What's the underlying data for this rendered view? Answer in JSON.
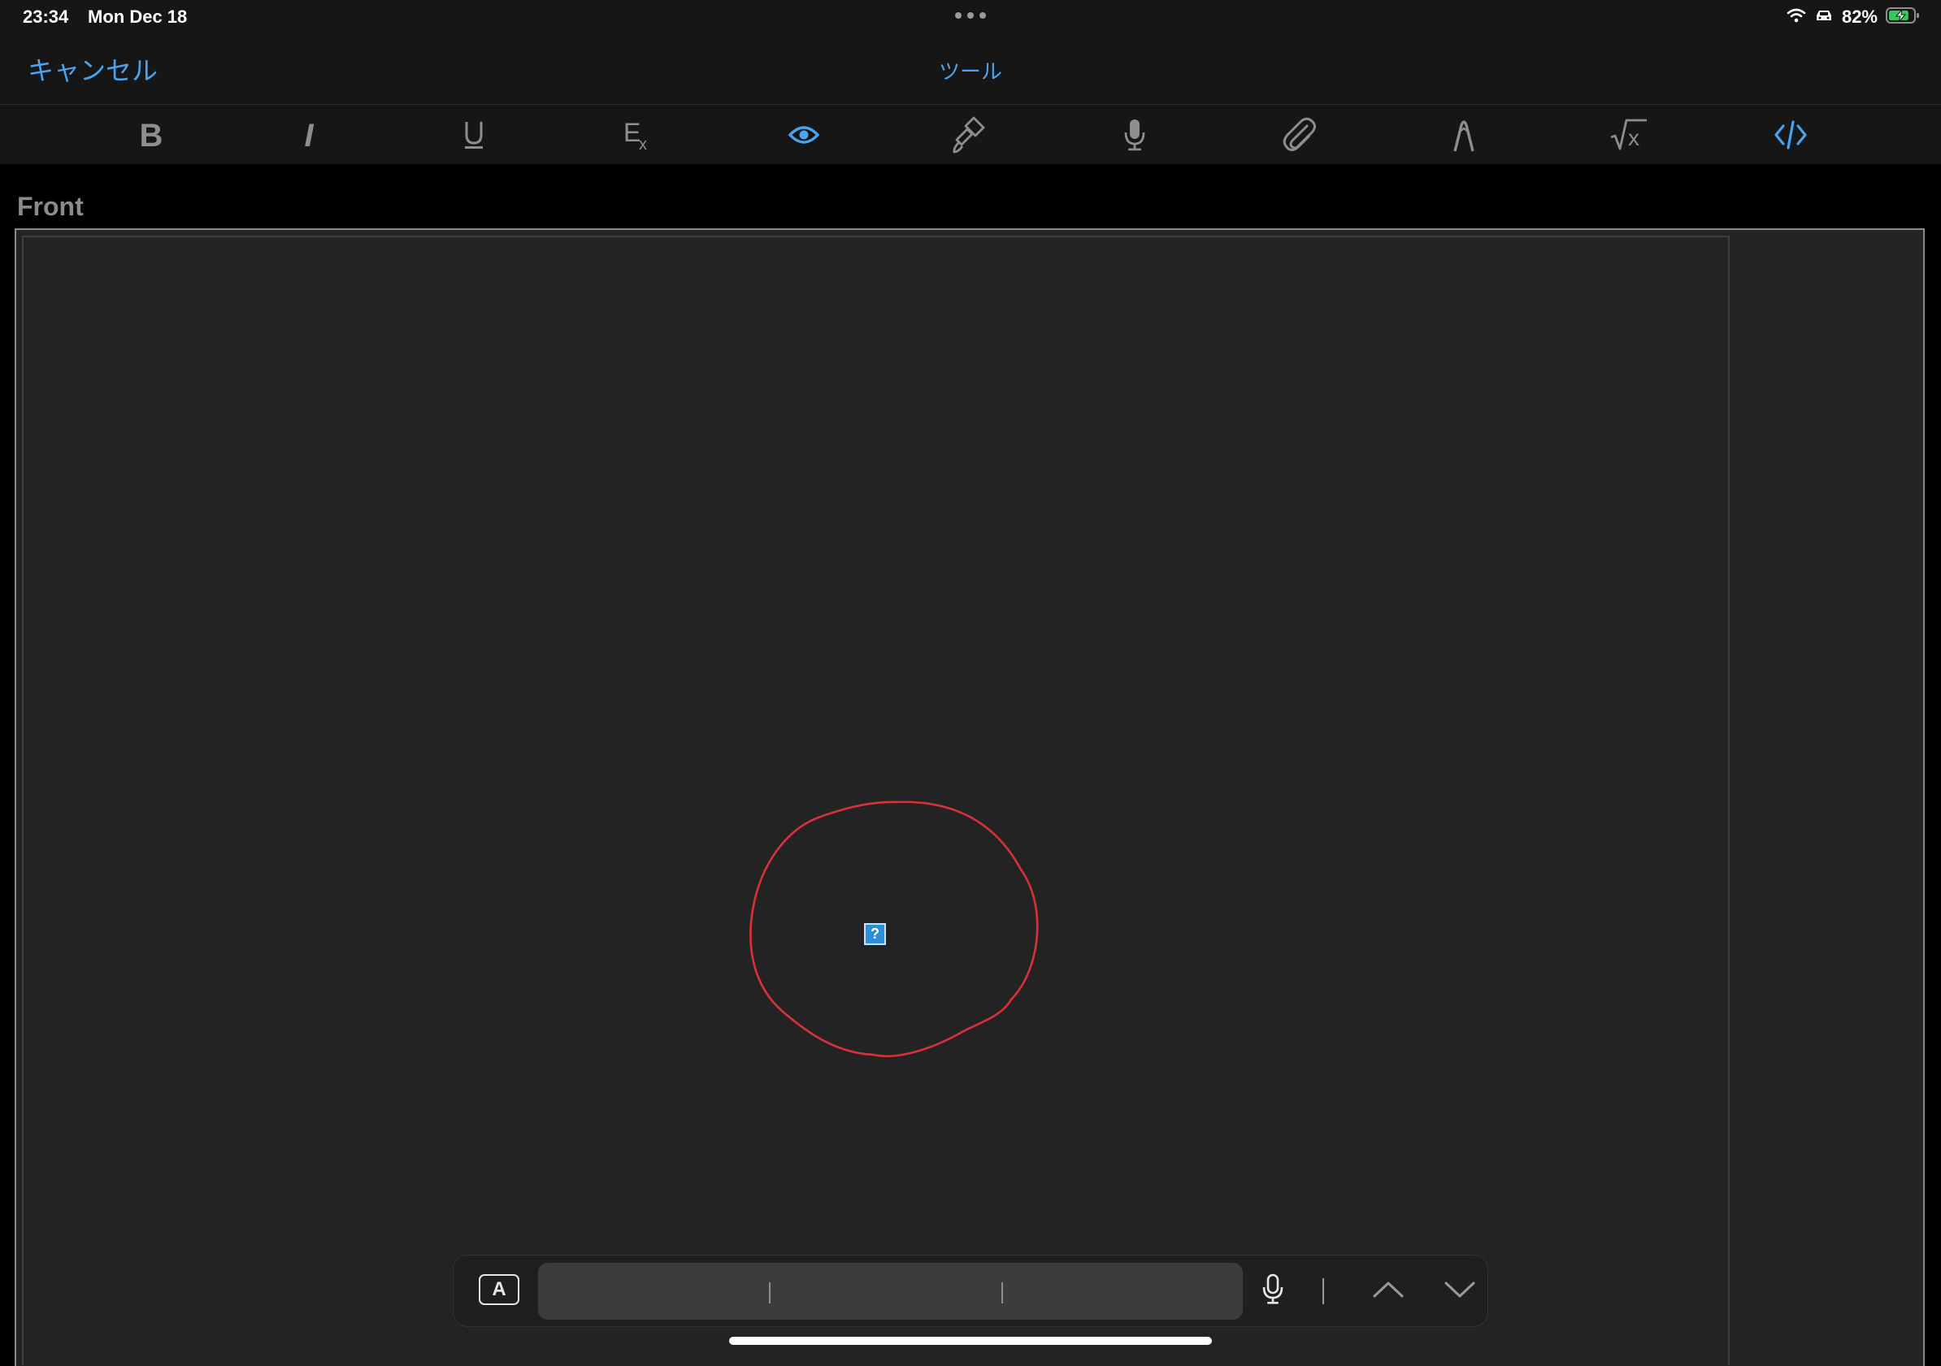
{
  "status_bar": {
    "time": "23:34",
    "date": "Mon Dec 18",
    "battery_percent": "82%",
    "battery_level": 0.82,
    "battery_charging": true,
    "icons": [
      "wifi-icon",
      "car-icon",
      "battery-charging-icon"
    ]
  },
  "nav": {
    "cancel_label": "キャンセル",
    "title": "ツール",
    "accent_color": "#4aa3ef"
  },
  "toolbar": {
    "tools": [
      {
        "name": "bold",
        "icon": "bold-icon",
        "active": false
      },
      {
        "name": "italic",
        "icon": "italic-icon",
        "active": false
      },
      {
        "name": "underline",
        "icon": "underline-icon",
        "active": false
      },
      {
        "name": "clear-formatting",
        "icon": "clear-formatting-icon",
        "active": false
      },
      {
        "name": "preview",
        "icon": "eye-icon",
        "active": true
      },
      {
        "name": "text-color",
        "icon": "paintbrush-icon",
        "active": false
      },
      {
        "name": "record-audio",
        "icon": "microphone-icon",
        "active": false
      },
      {
        "name": "attach",
        "icon": "paperclip-icon",
        "active": false
      },
      {
        "name": "draw",
        "icon": "pen-nib-icon",
        "active": false
      },
      {
        "name": "math",
        "icon": "square-root-icon",
        "active": false
      },
      {
        "name": "html-editor",
        "icon": "code-icon",
        "active": true
      }
    ],
    "active_color": "#4aa3ef",
    "inactive_color": "#8e8e8e"
  },
  "field": {
    "label": "Front"
  },
  "content": {
    "broken_image_glyph": "?",
    "annotation_color": "#d9313a"
  },
  "keyboard_bar": {
    "format_button_label": "A",
    "icons": [
      "microphone-icon",
      "chevron-up-icon",
      "chevron-down-icon"
    ]
  }
}
